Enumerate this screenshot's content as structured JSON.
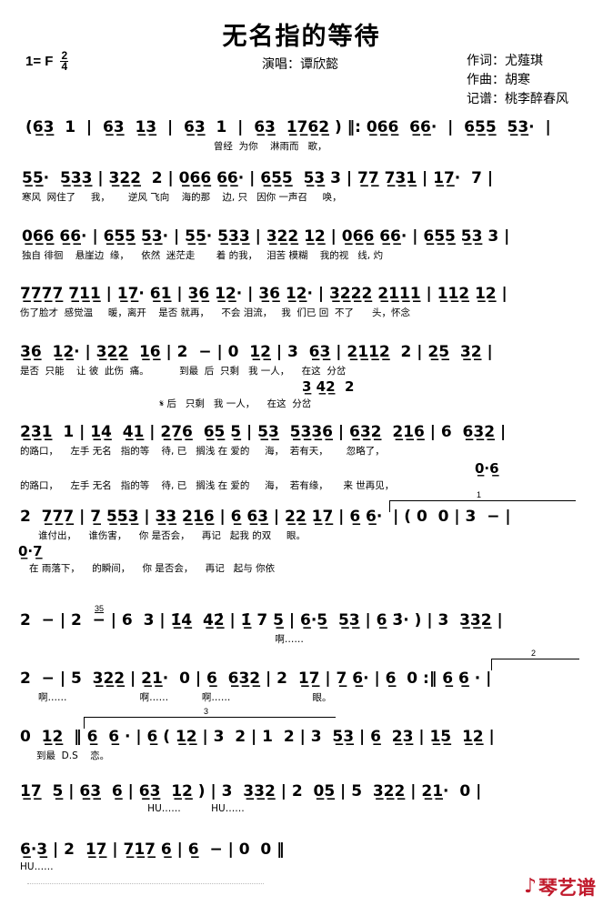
{
  "header": {
    "title": "无名指的等待",
    "key_label": "1= F",
    "time_numerator": "2",
    "time_denominator": "4",
    "singer": "演唱：谭欣懿",
    "credits": [
      "作词：尤薤琪",
      "作曲：胡寒",
      "记谱：桃李醉春风"
    ]
  },
  "staves": [
    {
      "id": "stave-1",
      "notes": "(6̲3̲  1  |  6̲3̲  1̲3̲  |  6̲3̲  1  |  6̲3̲  1̲7̲6̲2̲ ) ‖: 0̲6̲6̲  6̲6̲·  |  6̲5̲5̲  5̲3̲·  |",
      "lyrics": "                                                              曾经  为你    淋雨而   歌，",
      "lyrics_alt": ""
    },
    {
      "id": "stave-2",
      "notes": "5̲5̲·  5̲3̲3̲ | 3̲2̲2̲  2 | 0̲6̲6̲ 6̲6̲· | 6̲5̲5̲  5̲3̲ 3 | 7̲7̲ 7̲3̲1̲ | 1̲7̲·  7 |",
      "lyrics": "寒风  网住了     我，      逆风 飞向    海的那    边, 只   因你 一声召     唤，",
      "lyrics_alt": ""
    },
    {
      "id": "stave-3",
      "notes": "0̲6̲6̲ 6̲6̲· | 6̲5̲5̲ 5̲3̲· | 5̲5̲· 5̲3̲3̲ | 3̲2̲2̲ 1̲2̲ | 0̲6̲6̲ 6̲6̲· | 6̲5̲5̲ 5̲3̲ 3 |",
      "lyrics": "独自 徘徊    悬崖边  缘，    依然  迷茫走       着 的我，   泪苦 模糊    我的视   线, 灼",
      "lyrics_alt": ""
    },
    {
      "id": "stave-4",
      "notes": "7̲7̲7̲7̲ 7̲1̲1̲ | 1̲7̲· 6̲1̲ | 3̲6̲ 1̲2̲· | 3̲6̲ 1̲2̲· | 3̲2̲2̲2̲ 2̲1̲1̲1̲ | 1̲1̲2̲ 1̲2̲ |",
      "lyrics": "伤了脸才  感觉温     暖，离开    是否 就再，    不会 泪流，   我  们已 回  不了      头，怀念",
      "lyrics_alt": ""
    },
    {
      "id": "stave-5",
      "notes": "3̲6̲  1̲2̲· | 3̲2̲2̲  1̲6̲ | 2  − | 0  1̲2̲ | 3  6̲3̲ | 2̲1̲1̲2̲  2 | 2̲5̲  3̲2̲ |",
      "lyrics": "是否  只能    让 彼  此伤  痛。          到最  后  只剩   我 一人，    在这  分岔",
      "lyrics_alt": "                                              𝄋 后   只剩   我 一人，    在这  分岔",
      "alt_notes": "3̲ 4̲2̲  2"
    },
    {
      "id": "stave-6",
      "notes": "2̲3̲1̲  1 | 1̲4̲  4̲1̲ | 2̲7̲6̲  6̲5̲ 5̲ | 5̲3̲  5̲3̲3̲6̲ | 6̲3̲2̲  2̲1̲6̲ | 6  6̲3̲2̲ |",
      "lyrics": "的路口，    左手 无名   指的等    待, 已   搁浅 在 爱的     海，  若有天，      忽略了，",
      "lyrics_alt": "的路口，    左手 无名   指的等    待, 已   搁浅 在 爱的     海，  若有缘，     来 世再见，",
      "alt_notes": "0̲·6̲"
    },
    {
      "id": "stave-7",
      "notes": "2  7̲7̲7̲ | 7̲ 5̲5̲3̲ | 3̲3̲ 2̲1̲6̲ | 6̲ 6̲3̲ | 2̲2̲ 1̲7̲ | 6̲ 6̲·  | ( 0  0 | 3  − |",
      "lyrics": "      谁付出，    谁伤害，    你 是否会，    再记   起我 的双     眼。",
      "lyrics_alt": "   在 雨落下，    的瞬间，    你 是否会，    再记   起与 你依",
      "alt_notes": "0̲·7̲",
      "ending_bracket": "1"
    },
    {
      "id": "stave-8",
      "notes": "2  − | 2  − | 6  3 | 1̲̇4̲  4̲2̲̇ | 1̲̇ 7 5̲ | 6̲·5̲  5̲3̲ | 6̲ 3̇· ) | 3  3̲3̲2̲ |",
      "lyrics": "                                                                                    啊……",
      "lyrics_alt": "",
      "grace": "35"
    },
    {
      "id": "stave-9",
      "notes": "2  − | 5  3̲2̲2̲ | 2̲1̲·  0 | 6̲  6̲3̲2̲ | 2  1̲7̲ | 7̲ 6̲· | 6̲  0 :‖ 6̲ 6̲ · |",
      "lyrics": "      啊……                        啊……           啊……                           眼。",
      "lyrics_alt": "",
      "ending_bracket": "2"
    },
    {
      "id": "stave-10",
      "notes": "0  1̲2̲  ‖ 6̲  6̲ · | 6̲ ( 1̲2̲ | 3  2 | 1  2 | 3  5̲3̲ | 6̲  2̲3̲ | 1̲5̲  1̲2̲ |",
      "lyrics": "到最  D.S    恋。",
      "lyrics_alt": "",
      "ending_bracket": "3"
    },
    {
      "id": "stave-11",
      "notes": "1̲7̲  5̲ | 6̲3̲  6̲ | 6̲3̲  1̲2̲ ) | 3  3̲3̲2̲ | 2  0̲5̲ | 5  3̲2̲2̲ | 2̲1̲·  0 |",
      "lyrics": "                                          HU……          HU……",
      "lyrics_alt": ""
    },
    {
      "id": "stave-12",
      "notes": "6̲·3̲ | 2  1̲7̲ | 7̲1̲7̲ 6̲ | 6̲  − | 0  0 ‖",
      "lyrics": "HU……",
      "lyrics_alt": ""
    }
  ],
  "watermark": {
    "glyph": "♪",
    "text": "琴艺谱",
    "color": "#c0192b"
  }
}
